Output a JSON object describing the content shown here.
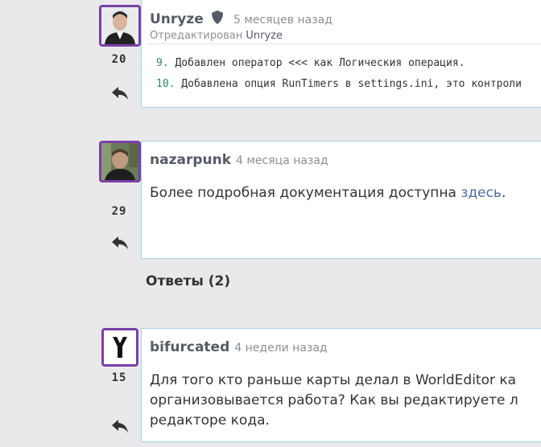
{
  "comments": [
    {
      "author": "Unryze",
      "time": "5 месяцев назад",
      "edited_prefix": "Отредактирован",
      "edited_by": "Unryze",
      "score": "20",
      "code_lines": [
        {
          "num": "9.",
          "text": " Добавлен оператор <<< как Логическия операция."
        },
        {
          "num": "10.",
          "text": " Добавлена опция RunTimers в settings.ini, это контроли"
        }
      ]
    },
    {
      "author": "nazarpunk",
      "time": "4 месяца назад",
      "score": "29",
      "text": "Более подробная документация доступна ",
      "link_text": "здесь",
      "text_after": "."
    },
    {
      "author": "bifurcated",
      "time": "4 недели назад",
      "score": "15",
      "text_lines": [
        "Для того кто раньше карты делал в WorldEditor ка",
        "организовывается работа? Как вы редактируете л",
        "редакторе кода."
      ]
    }
  ],
  "replies_header": "Ответы (2)",
  "colors": {
    "avatar_border": "#7b3fa6",
    "link": "#4d6fa3",
    "card_border": "#a7d3e9",
    "code_number": "#2e8b57"
  },
  "icons": [
    "reply-icon",
    "shield-icon"
  ]
}
